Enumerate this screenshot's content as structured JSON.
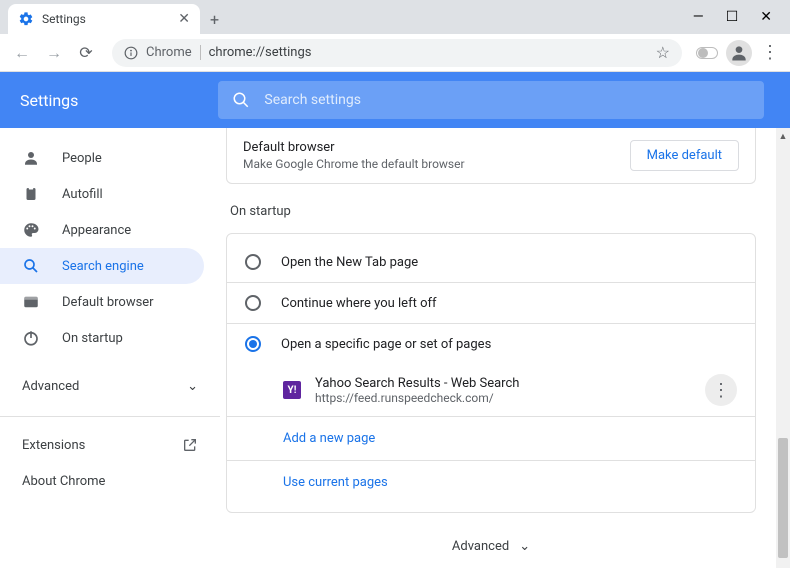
{
  "window": {
    "tab_title": "Settings"
  },
  "omnibox": {
    "chip": "Chrome",
    "url": "chrome://settings"
  },
  "header": {
    "title": "Settings",
    "search_placeholder": "Search settings"
  },
  "sidebar": {
    "items": [
      {
        "label": "People"
      },
      {
        "label": "Autofill"
      },
      {
        "label": "Appearance"
      },
      {
        "label": "Search engine"
      },
      {
        "label": "Default browser"
      },
      {
        "label": "On startup"
      }
    ],
    "advanced": "Advanced",
    "extensions": "Extensions",
    "about": "About Chrome"
  },
  "default_browser": {
    "title": "Default browser",
    "subtitle": "Make Google Chrome the default browser",
    "button": "Make default"
  },
  "startup": {
    "heading": "On startup",
    "options": [
      "Open the New Tab page",
      "Continue where you left off",
      "Open a specific page or set of pages"
    ],
    "page_entry": {
      "title": "Yahoo Search Results - Web Search",
      "url": "https://feed.runspeedcheck.com/"
    },
    "add_page": "Add a new page",
    "use_current": "Use current pages"
  },
  "advanced_center": "Advanced"
}
